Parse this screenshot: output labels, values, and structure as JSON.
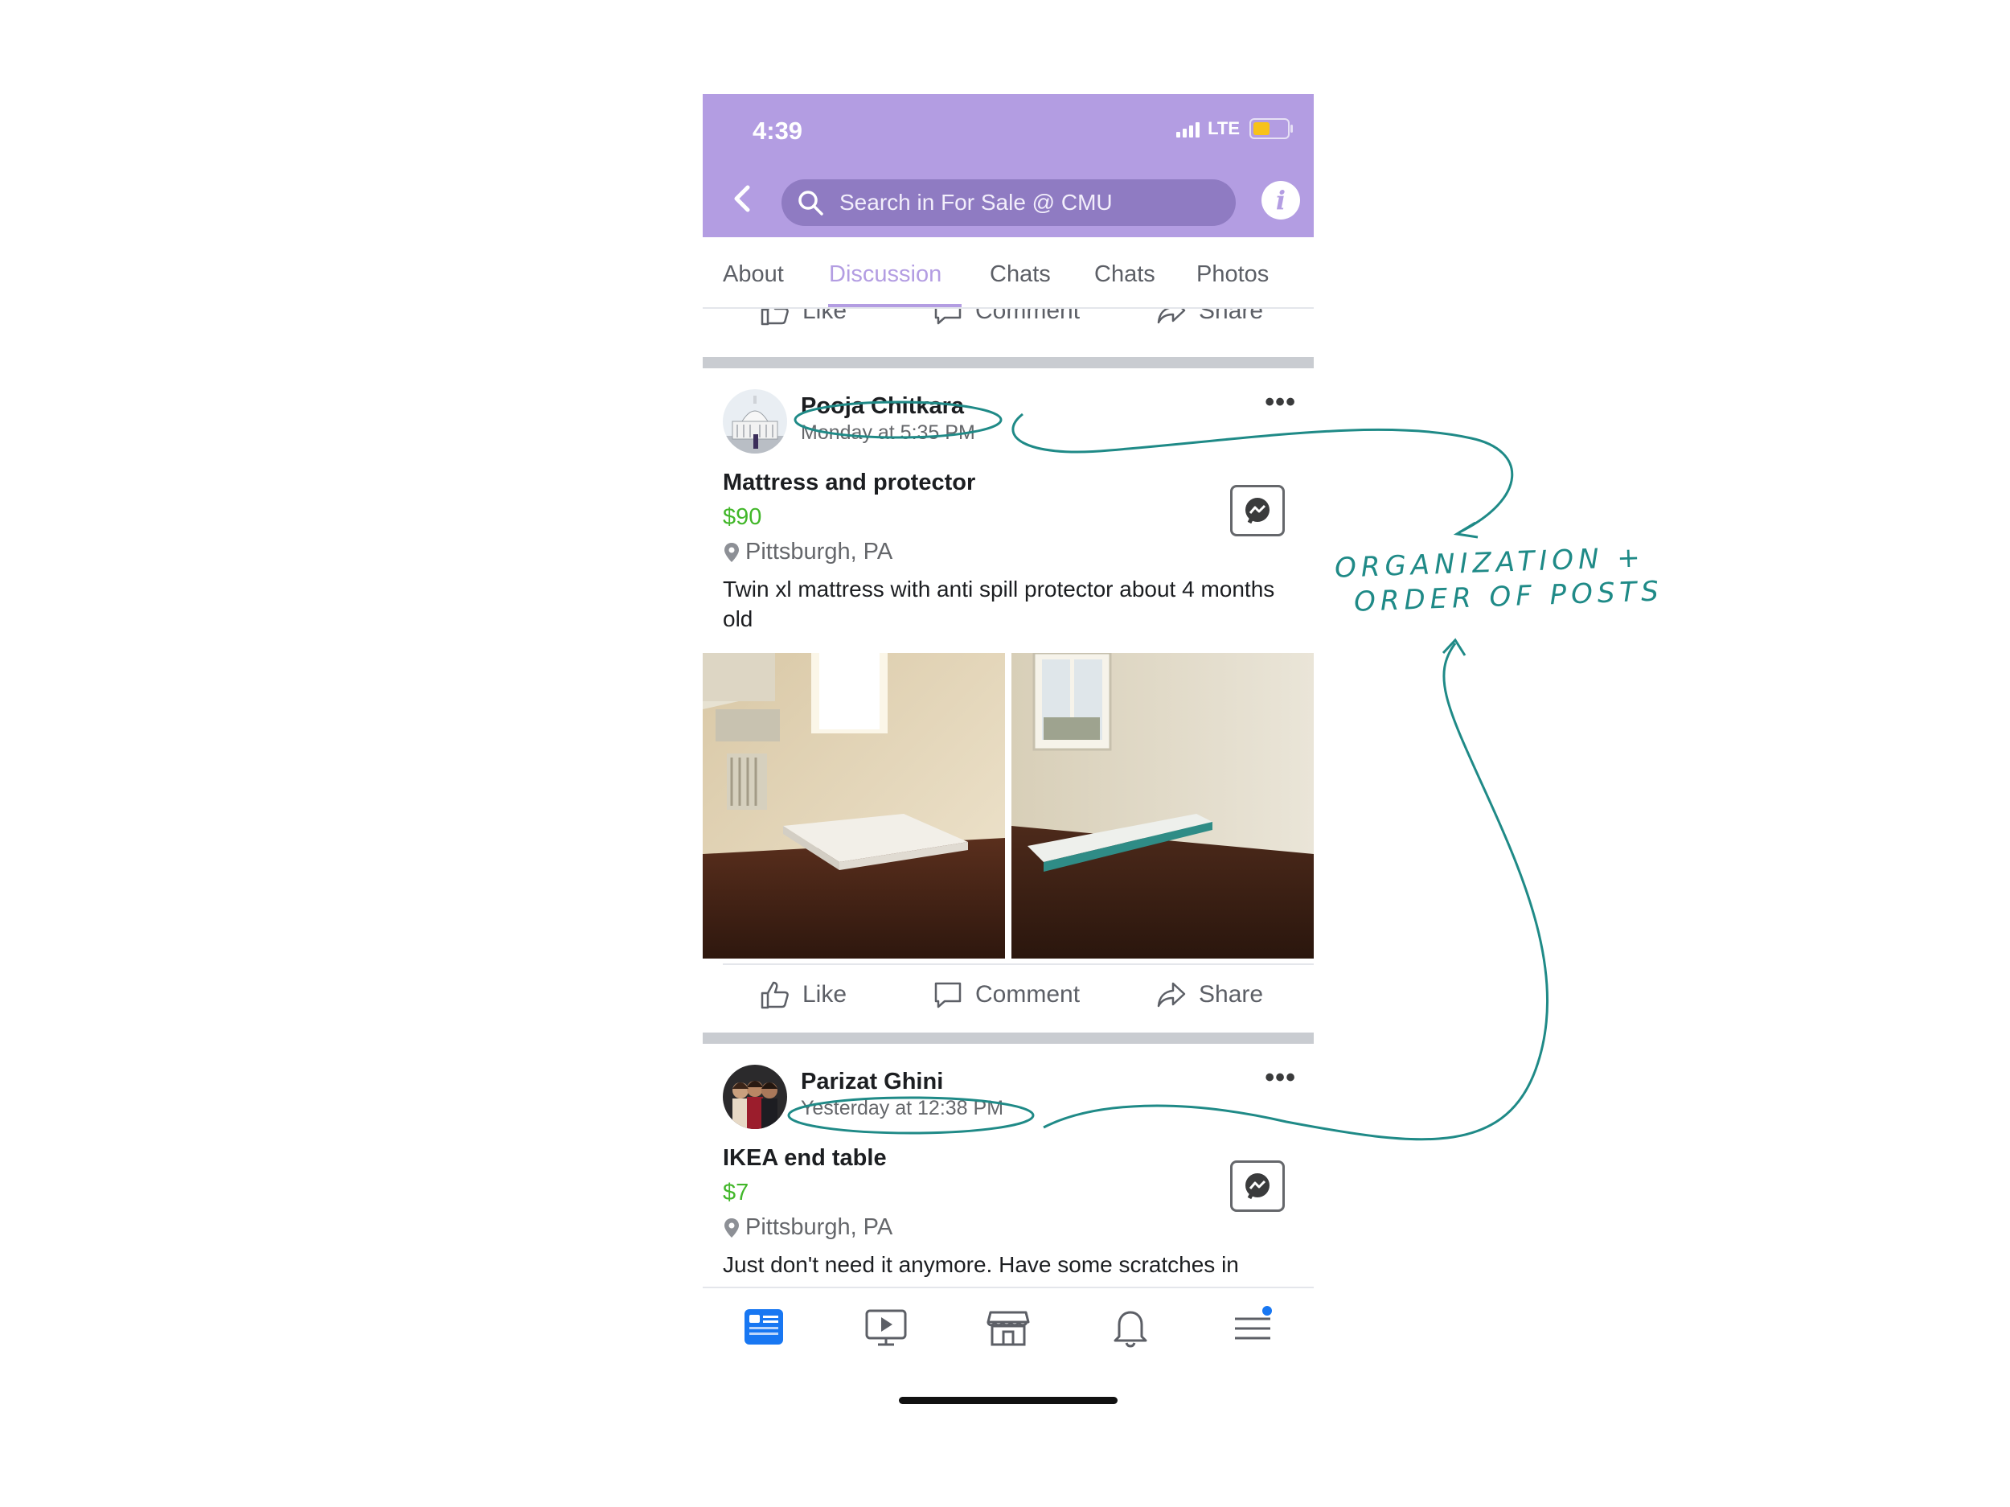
{
  "status": {
    "time": "4:39",
    "network": "LTE"
  },
  "header": {
    "search_placeholder": "Search in For Sale @ CMU",
    "info_label": "i"
  },
  "tabs": [
    {
      "label": "About"
    },
    {
      "label": "Discussion",
      "active": true
    },
    {
      "label": "Chats"
    },
    {
      "label": "Chats"
    },
    {
      "label": "Photos"
    }
  ],
  "actions": {
    "like": "Like",
    "comment": "Comment",
    "share": "Share"
  },
  "posts": [
    {
      "author": "Pooja Chitkara",
      "timestamp": "Monday at 5:35 PM",
      "title": "Mattress and protector",
      "price": "$90",
      "location": "Pittsburgh, PA",
      "description": "Twin xl mattress with anti spill protector about 4 months old"
    },
    {
      "author": "Parizat Ghini",
      "timestamp": "Yesterday at 12:38 PM",
      "title": "IKEA end table",
      "price": "$7",
      "location": "Pittsburgh, PA",
      "description": "Just don't need it anymore. Have some scratches in"
    }
  ],
  "bottom_nav": [
    "feed-icon",
    "watch-icon",
    "marketplace-icon",
    "notifications-icon",
    "menu-icon"
  ],
  "annotation": {
    "line1": "ORGANIZATION +",
    "line2": "ORDER OF POSTS"
  },
  "colors": {
    "header": "#b39de2",
    "accent": "#b39de2",
    "price": "#42b72a",
    "annotation": "#1f8a87",
    "nav_active": "#1877f2"
  }
}
